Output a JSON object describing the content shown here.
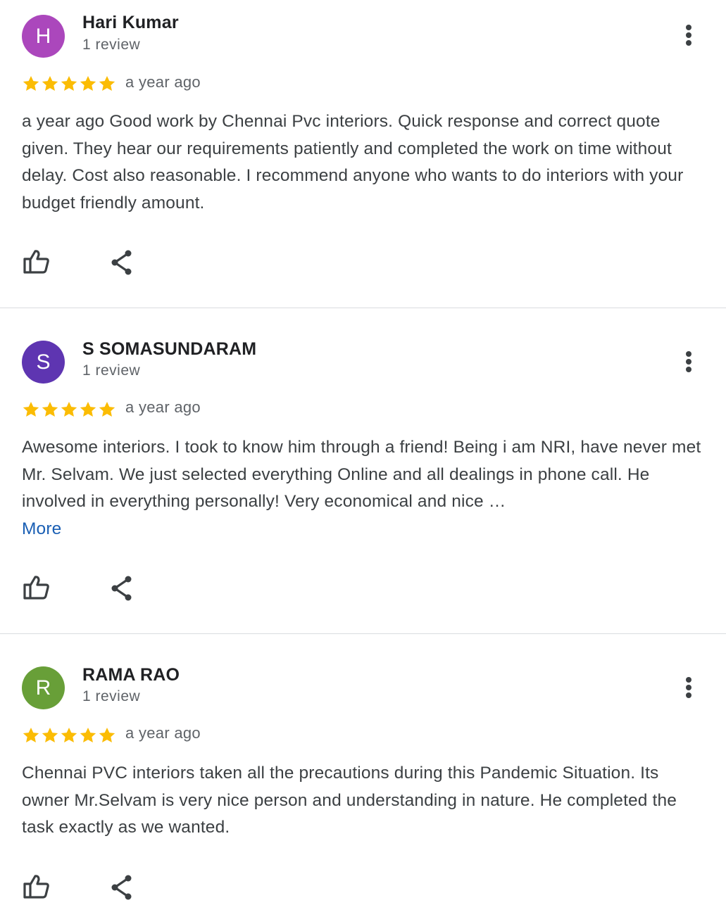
{
  "colors": {
    "star": "#fbbc04",
    "link": "#1a5fb4"
  },
  "reviews": [
    {
      "avatar_letter": "H",
      "avatar_color": "#ab47bc",
      "name": "Hari Kumar",
      "review_count": "1 review",
      "rating": 5,
      "time": "a year ago",
      "text": "a year ago Good work by Chennai Pvc interiors. Quick response and correct quote given. They hear our requirements patiently and completed the work on time without delay. Cost also reasonable. I recommend anyone who wants to do interiors with your budget friendly amount.",
      "more_label": "",
      "like_icon": "thumbs-up-icon",
      "share_icon": "share-icon",
      "menu_icon": "more-vert-icon"
    },
    {
      "avatar_letter": "S",
      "avatar_color": "#5e35b1",
      "name": "S SOMASUNDARAM",
      "review_count": "1 review",
      "rating": 5,
      "time": "a year ago",
      "text": "Awesome interiors. I took to know him through a friend! Being i am NRI, have never met Mr. Selvam. We just selected everything Online and all dealings in phone call. He involved in everything personally! Very economical and nice …",
      "more_label": "More",
      "like_icon": "thumbs-up-icon",
      "share_icon": "share-icon",
      "menu_icon": "more-vert-icon"
    },
    {
      "avatar_letter": "R",
      "avatar_color": "#689f38",
      "name": "RAMA RAO",
      "review_count": "1 review",
      "rating": 5,
      "time": "a year ago",
      "text": "Chennai PVC interiors taken all the precautions during this Pandemic Situation. Its owner Mr.Selvam is very nice person and understanding in nature. He completed the task exactly as we wanted.",
      "more_label": "",
      "like_icon": "thumbs-up-icon",
      "share_icon": "share-icon",
      "menu_icon": "more-vert-icon"
    }
  ]
}
